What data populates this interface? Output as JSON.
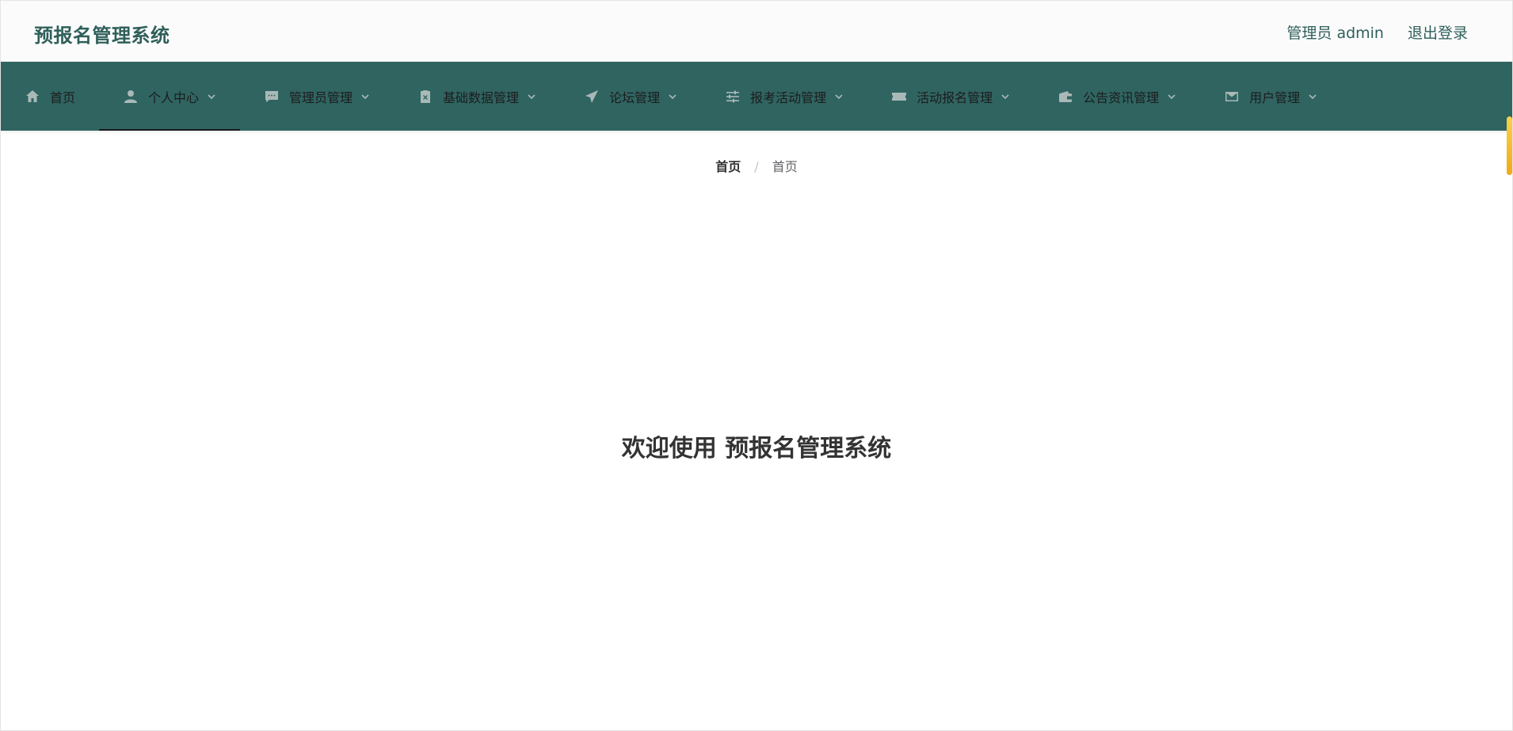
{
  "header": {
    "brand": "预报名管理系统",
    "user_label": "管理员 admin",
    "logout_label": "退出登录"
  },
  "nav": {
    "items": [
      {
        "label": "首页",
        "icon": "home-icon",
        "dropdown": false
      },
      {
        "label": "个人中心",
        "icon": "user-icon",
        "dropdown": true,
        "active": true
      },
      {
        "label": "管理员管理",
        "icon": "chat-icon",
        "dropdown": true
      },
      {
        "label": "基础数据管理",
        "icon": "clipboard-icon",
        "dropdown": true
      },
      {
        "label": "论坛管理",
        "icon": "send-icon",
        "dropdown": true
      },
      {
        "label": "报考活动管理",
        "icon": "sliders-icon",
        "dropdown": true
      },
      {
        "label": "活动报名管理",
        "icon": "ticket-icon",
        "dropdown": true
      },
      {
        "label": "公告资讯管理",
        "icon": "wallet-icon",
        "dropdown": true
      },
      {
        "label": "用户管理",
        "icon": "mail-icon",
        "dropdown": true
      }
    ]
  },
  "breadcrumb": {
    "first": "首页",
    "separator": "/",
    "current": "首页"
  },
  "main": {
    "welcome": "欢迎使用 预报名管理系统"
  },
  "colors": {
    "nav_bg": "#2f6461",
    "brand": "#2f5f5a",
    "scroll_thumb": "#f1a918"
  }
}
